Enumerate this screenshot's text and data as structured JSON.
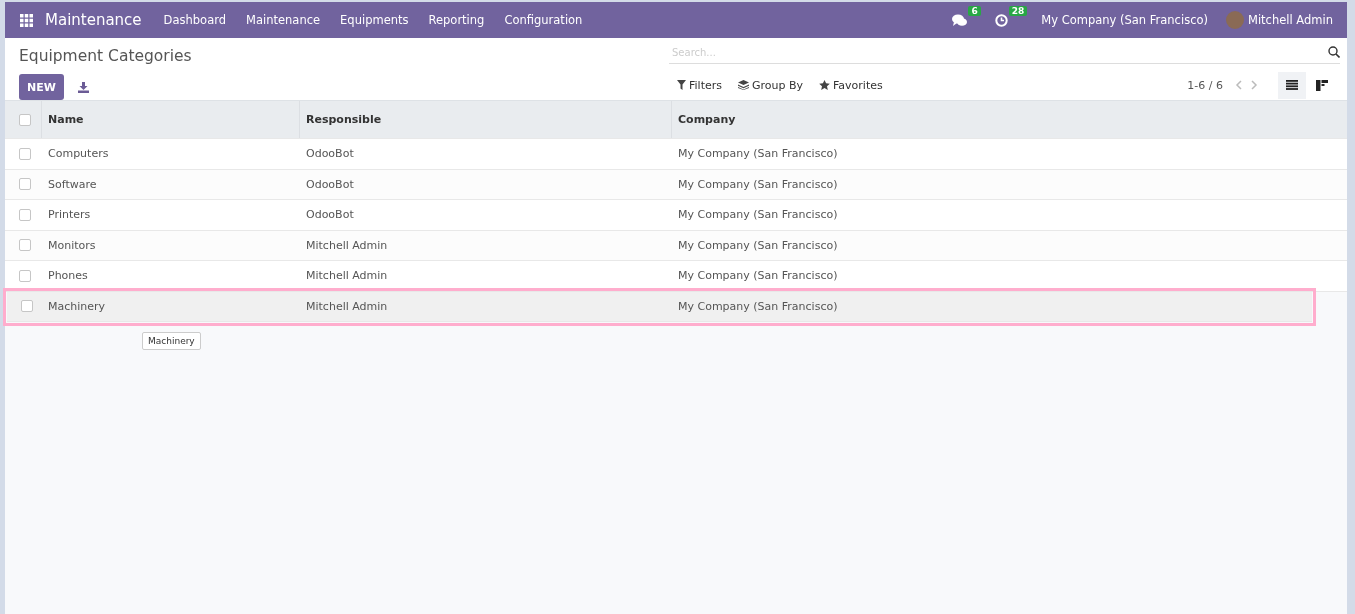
{
  "navbar": {
    "app_name": "Maintenance",
    "menu": [
      "Dashboard",
      "Maintenance",
      "Equipments",
      "Reporting",
      "Configuration"
    ],
    "messages_badge": "6",
    "activities_badge": "28",
    "company": "My Company (San Francisco)",
    "user": "Mitchell Admin"
  },
  "control_panel": {
    "title": "Equipment Categories",
    "new_button": "NEW",
    "search": {
      "placeholder": "Search..."
    },
    "search_options": [
      {
        "kind": "filter",
        "label": "Filters"
      },
      {
        "kind": "group",
        "label": "Group By"
      },
      {
        "kind": "favorite",
        "label": "Favorites"
      }
    ],
    "pager": "1-6 / 6",
    "views": [
      {
        "kind": "list",
        "selected": true
      },
      {
        "kind": "kanban",
        "selected": false
      }
    ]
  },
  "table": {
    "all_selected": false,
    "columns": [
      "Name",
      "Responsible",
      "Company"
    ],
    "rows": [
      {
        "cells": [
          "Computers",
          "OdooBot",
          "My Company (San Francisco)"
        ],
        "selected": false,
        "highlighted": false
      },
      {
        "cells": [
          "Software",
          "OdooBot",
          "My Company (San Francisco)"
        ],
        "selected": false,
        "highlighted": false
      },
      {
        "cells": [
          "Printers",
          "OdooBot",
          "My Company (San Francisco)"
        ],
        "selected": false,
        "highlighted": false
      },
      {
        "cells": [
          "Monitors",
          "Mitchell Admin",
          "My Company (San Francisco)"
        ],
        "selected": false,
        "highlighted": false
      },
      {
        "cells": [
          "Phones",
          "Mitchell Admin",
          "My Company (San Francisco)"
        ],
        "selected": false,
        "highlighted": false
      },
      {
        "cells": [
          "Machinery",
          "Mitchell Admin",
          "My Company (San Francisco)"
        ],
        "selected": false,
        "highlighted": true
      }
    ]
  },
  "tooltip": {
    "text": "Machinery"
  }
}
